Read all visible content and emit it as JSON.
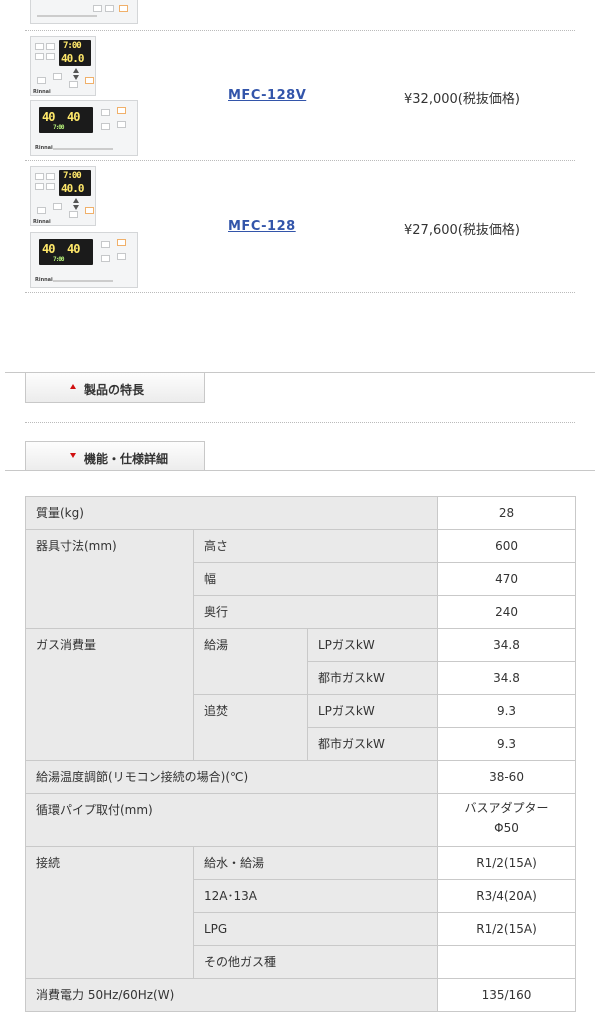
{
  "products": [
    {
      "model": "MFC-128V",
      "price": "¥32,000(税抜価格)",
      "remote_main": {
        "top": "7:00",
        "bottom": "40.0"
      },
      "remote_bath": {
        "left": "40",
        "right": "40",
        "small": "7:00"
      }
    },
    {
      "model": "MFC-128",
      "price": "¥27,600(税抜価格)",
      "remote_main": {
        "top": "7:00",
        "bottom": "40.0"
      },
      "remote_bath": {
        "left": "40",
        "right": "40",
        "small": "7:00"
      }
    }
  ],
  "remote_brand": "Rinnai",
  "sections": {
    "features_label": "製品の特長",
    "specs_label": "機能・仕様詳細"
  },
  "specs": {
    "weight": {
      "label": "質量(kg)",
      "value": "28"
    },
    "dims": {
      "label": "器具寸法(mm)",
      "height": {
        "label": "高さ",
        "value": "600"
      },
      "width": {
        "label": "幅",
        "value": "470"
      },
      "depth": {
        "label": "奥行",
        "value": "240"
      }
    },
    "gas": {
      "label": "ガス消費量",
      "supply": {
        "label": "給湯",
        "lp": {
          "label": "LPガスkW",
          "value": "34.8"
        },
        "city": {
          "label": "都市ガスkW",
          "value": "34.8"
        }
      },
      "reheat": {
        "label": "追焚",
        "lp": {
          "label": "LPガスkW",
          "value": "9.3"
        },
        "city": {
          "label": "都市ガスkW",
          "value": "9.3"
        }
      }
    },
    "temp": {
      "label": "給湯温度調節(リモコン接続の場合)(℃)",
      "value": "38-60"
    },
    "pipe": {
      "label": "循環パイプ取付(mm)",
      "value1": "バスアダプター",
      "value2": "Φ50"
    },
    "conn": {
      "label": "接続",
      "water": {
        "label": "給水・給湯",
        "value": "R1/2(15A)"
      },
      "a13": {
        "label": "12A･13A",
        "value": "R3/4(20A)"
      },
      "lpg": {
        "label": "LPG",
        "value": "R1/2(15A)"
      },
      "other": {
        "label": "その他ガス種",
        "value": ""
      }
    },
    "power": {
      "label": "消費電力 50Hz/60Hz(W)",
      "value": "135/160"
    }
  },
  "colors": {
    "link": "#3355aa",
    "accent_red": "#d01010",
    "row_gray": "#eaeaea",
    "lcd_yellow": "#ffe86a"
  }
}
